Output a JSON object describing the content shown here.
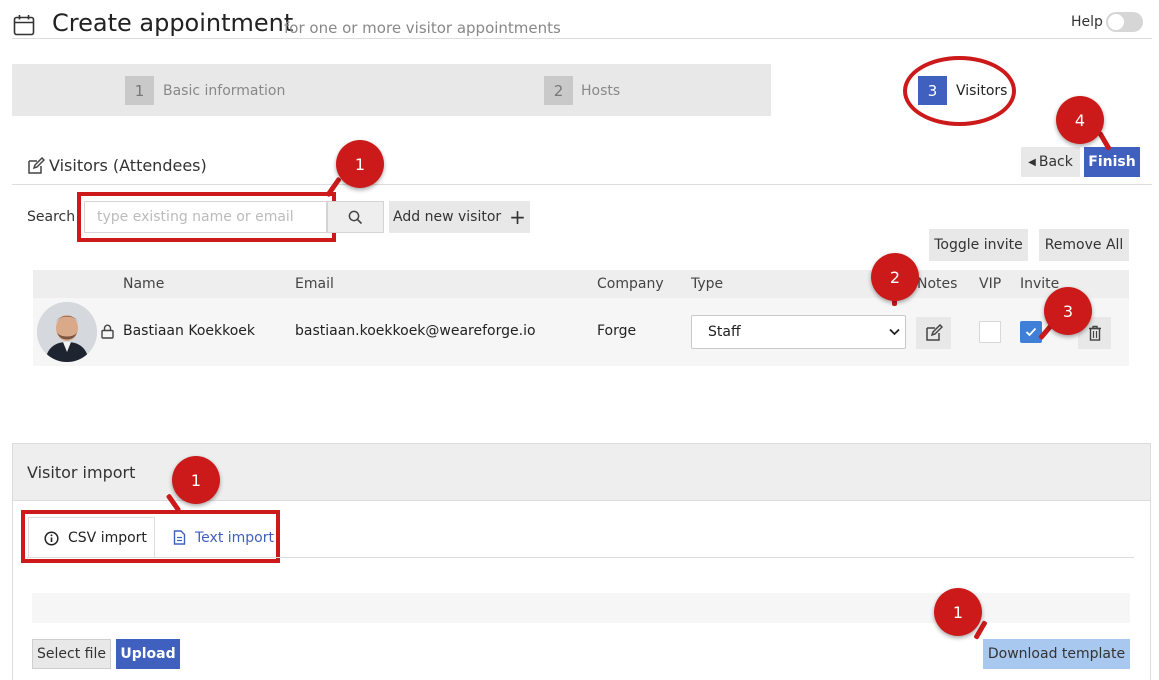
{
  "header": {
    "title": "Create appointment",
    "subtitle": "for one or more visitor appointments",
    "help_label": "Help",
    "icon": "calendar-icon"
  },
  "steps": [
    {
      "number": "1",
      "label": "Basic information",
      "active": false
    },
    {
      "number": "2",
      "label": "Hosts",
      "active": false
    },
    {
      "number": "3",
      "label": "Visitors",
      "active": true
    }
  ],
  "visitors_section": {
    "title": "Visitors (Attendees)",
    "back_label": "Back",
    "finish_label": "Finish",
    "search_label": "Search",
    "search_placeholder": "type existing name or email",
    "add_visitor_label": "Add new visitor",
    "toggle_invite_label": "Toggle invite",
    "remove_all_label": "Remove All"
  },
  "table": {
    "columns": [
      "Name",
      "Email",
      "Company",
      "Type",
      "Notes",
      "VIP",
      "Invite"
    ],
    "rows": [
      {
        "name": "Bastiaan Koekkoek",
        "email": "bastiaan.koekkoek@weareforge.io",
        "company": "Forge",
        "type": "Staff",
        "vip": false,
        "invite": true
      }
    ]
  },
  "import": {
    "title": "Visitor import",
    "tabs": [
      {
        "label": "CSV import",
        "icon": "info-circle-icon",
        "active": true
      },
      {
        "label": "Text import",
        "icon": "document-icon",
        "active": false
      }
    ],
    "select_file_label": "Select file",
    "upload_label": "Upload",
    "download_template_label": "Download template"
  },
  "annotations": {
    "search_badge": "1",
    "type_badge": "2",
    "invite_badge": "3",
    "finish_badge": "4",
    "import_tabs_badge": "1",
    "download_badge": "1"
  },
  "colors": {
    "primary": "#4060c0",
    "annotation_red": "#cc1a1a",
    "checkbox_blue": "#3f7fd8",
    "download_button": "#a9c8f0"
  }
}
